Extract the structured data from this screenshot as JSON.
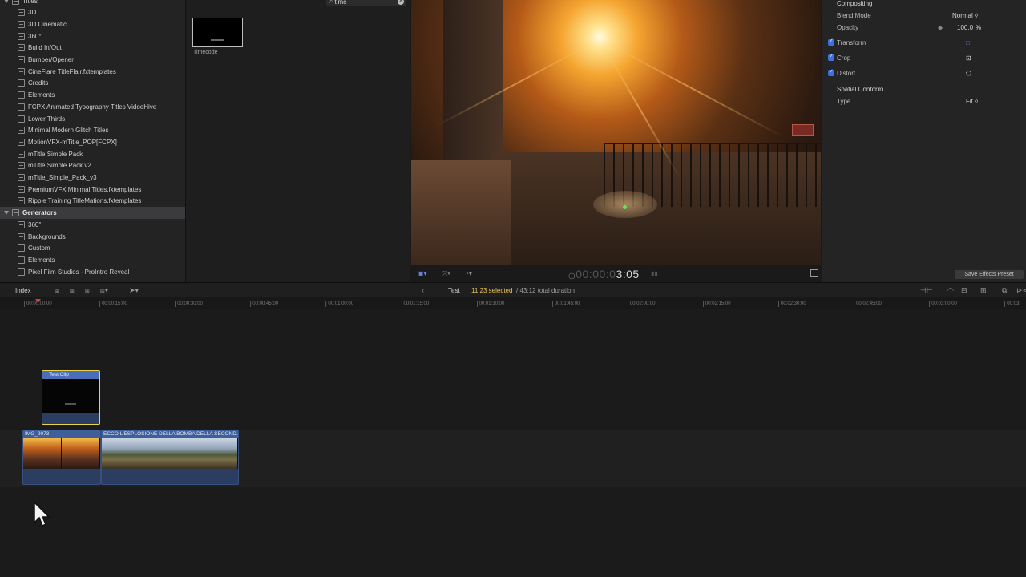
{
  "sidebar": {
    "items": [
      {
        "label": "Titles",
        "kind": "parent"
      },
      {
        "label": "3D",
        "kind": "child"
      },
      {
        "label": "3D Cinematic",
        "kind": "child"
      },
      {
        "label": "360°",
        "kind": "child"
      },
      {
        "label": "Build In/Out",
        "kind": "child"
      },
      {
        "label": "Bumper/Opener",
        "kind": "child"
      },
      {
        "label": "CineFlare TitleFlair.fxtemplates",
        "kind": "child"
      },
      {
        "label": "Credits",
        "kind": "child"
      },
      {
        "label": "Elements",
        "kind": "child"
      },
      {
        "label": "FCPX Animated Typography Titles VidoeHive",
        "kind": "child"
      },
      {
        "label": "Lower Thirds",
        "kind": "child"
      },
      {
        "label": "Minimal Modern Glitch Titles",
        "kind": "child"
      },
      {
        "label": "MotionVFX-mTitle_POP[FCPX]",
        "kind": "child"
      },
      {
        "label": "mTitle Simple Pack",
        "kind": "child"
      },
      {
        "label": "mTitle Simple Pack v2",
        "kind": "child"
      },
      {
        "label": "mTitle_Simple_Pack_v3",
        "kind": "child"
      },
      {
        "label": "PremiumVFX Minimal Titles.fxtemplates",
        "kind": "child"
      },
      {
        "label": "Ripple Training TitleMations.fxtemplates",
        "kind": "child"
      },
      {
        "label": "Generators",
        "kind": "parent",
        "selected": true
      },
      {
        "label": "360°",
        "kind": "child"
      },
      {
        "label": "Backgrounds",
        "kind": "child"
      },
      {
        "label": "Custom",
        "kind": "child"
      },
      {
        "label": "Elements",
        "kind": "child"
      },
      {
        "label": "Pixel Film Studios - ProIntro Reveal",
        "kind": "child"
      }
    ]
  },
  "browser": {
    "search_value": "time",
    "search_icon": "magnifier-icon",
    "result": {
      "label": "Timecode"
    }
  },
  "viewer": {
    "timecode_dim": "00:00:0",
    "timecode_live": "3:05",
    "layout_icon": "viewer-layout-icon",
    "transform_icon": "transform-tool-icon",
    "speed_icon": "speed-icon",
    "fullscreen_icon": "fullscreen-icon"
  },
  "inspector": {
    "compositing_header": "Compositing",
    "blend_mode": {
      "label": "Blend Mode",
      "value": "Normal ◊"
    },
    "opacity": {
      "label": "Opacity",
      "value": "100,0",
      "unit": "%"
    },
    "transform": {
      "label": "Transform",
      "icon": "□"
    },
    "crop": {
      "label": "Crop",
      "icon": "⊡"
    },
    "distort": {
      "label": "Distort",
      "icon": "⬠"
    },
    "spatial_conform": "Spatial Conform",
    "type": {
      "label": "Type",
      "value": "Fit ◊"
    },
    "save_preset": "Save Effects Preset"
  },
  "timeline_bar": {
    "index_label": "Index",
    "back_arrow": "‹",
    "project_name": "Test",
    "selected": "11:23 selected",
    "total": "/ 43:12 total duration"
  },
  "ruler": {
    "ticks": [
      "00:00:00:00",
      "00:00:15:00",
      "00:00:30:00",
      "00:00:45:00",
      "00:01:00:00",
      "00:01:15:00",
      "00:01:30:00",
      "00:01:45:00",
      "00:02:00:00",
      "00:02:15:00",
      "00:02:30:00",
      "00:02:45:00",
      "00:03:00:00",
      "00:03:"
    ]
  },
  "clips": {
    "title_clip": "Test Clip",
    "clip1": "IMG_9073",
    "clip2": "ECCO L'ESPLOSIONE DELLA BOMBA DELLA SECOND..."
  },
  "colors": {
    "accent": "#e8c25a",
    "playhead": "#c04a3c",
    "checkbox": "#3e6fe0",
    "clip_blue": "#2b3e62"
  }
}
